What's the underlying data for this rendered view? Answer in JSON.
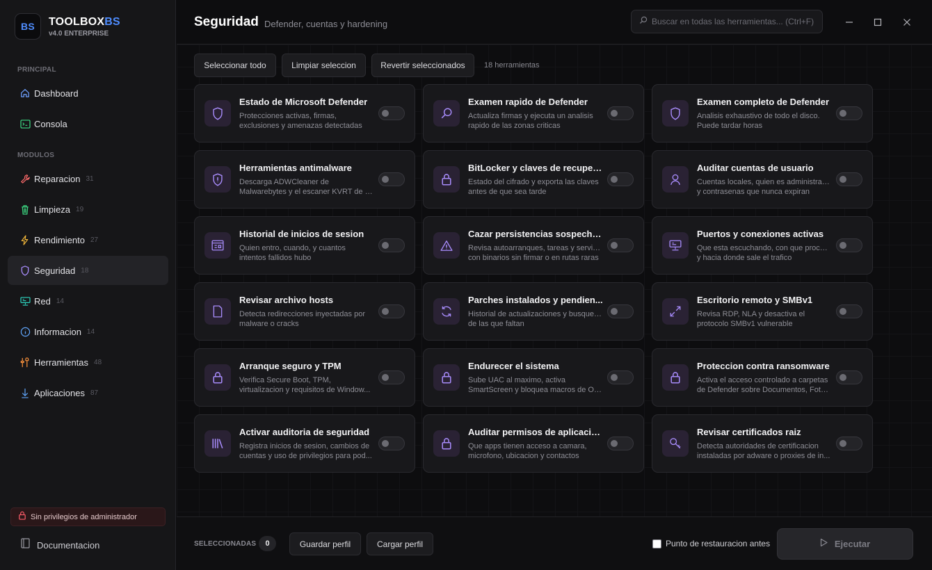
{
  "app": {
    "name_main": "TOOLBOX",
    "name_accent": "BS",
    "logo_text": "BS",
    "version": "v4.0 ENTERPRISE"
  },
  "sidebar": {
    "section_main": "PRINCIPAL",
    "section_modules": "MODULOS",
    "main_items": [
      {
        "label": "Dashboard",
        "icon": "home-icon"
      },
      {
        "label": "Consola",
        "icon": "terminal-icon"
      }
    ],
    "module_items": [
      {
        "label": "Reparacion",
        "count": "31",
        "icon": "wrench-icon",
        "color": "#ff6b6b"
      },
      {
        "label": "Limpieza",
        "count": "19",
        "icon": "trash-icon",
        "color": "#3ddc84"
      },
      {
        "label": "Rendimiento",
        "count": "27",
        "icon": "bolt-icon",
        "color": "#f5b93a"
      },
      {
        "label": "Seguridad",
        "count": "18",
        "icon": "shield-icon",
        "color": "#a78bfa"
      },
      {
        "label": "Red",
        "count": "14",
        "icon": "network-icon",
        "color": "#2dd4bf"
      },
      {
        "label": "Informacion",
        "count": "14",
        "icon": "info-icon",
        "color": "#60a5fa"
      },
      {
        "label": "Herramientas",
        "count": "48",
        "icon": "tools-icon",
        "color": "#fb923c"
      },
      {
        "label": "Aplicaciones",
        "count": "87",
        "icon": "download-icon",
        "color": "#60a5fa"
      }
    ],
    "admin_warning": "Sin privilegios de administrador",
    "docs_label": "Documentacion"
  },
  "header": {
    "title": "Seguridad",
    "subtitle": "Defender, cuentas y hardening",
    "search_placeholder": "Buscar en todas las herramientas... (Ctrl+F)"
  },
  "toolbar": {
    "select_all": "Seleccionar todo",
    "clear_selection": "Limpiar seleccion",
    "revert_selected": "Revertir seleccionados",
    "tool_count": "18 herramientas"
  },
  "tools": [
    {
      "title": "Estado de Microsoft Defender",
      "desc1": "Protecciones activas, firmas,",
      "desc2": "exclusiones y amenazas detectadas",
      "icon": "shield-icon",
      "enabled": false
    },
    {
      "title": "Examen rapido de Defender",
      "desc1": "Actualiza firmas y ejecuta un analisis",
      "desc2": "rapido de las zonas criticas",
      "icon": "search-icon",
      "enabled": false
    },
    {
      "title": "Examen completo de Defender",
      "desc1": "Analisis exhaustivo de todo el disco.",
      "desc2": "Puede tardar horas",
      "icon": "shield-icon",
      "enabled": false
    },
    {
      "title": "Herramientas antimalware",
      "desc1": "Descarga ADWCleaner de",
      "desc2": "Malwarebytes y el escaner KVRT de K...",
      "icon": "shield-alert-icon",
      "enabled": false
    },
    {
      "title": "BitLocker y claves de recuper...",
      "desc1": "Estado del cifrado y exporta las claves",
      "desc2": "antes de que sea tarde",
      "icon": "lock-icon",
      "enabled": false
    },
    {
      "title": "Auditar cuentas de usuario",
      "desc1": "Cuentas locales, quien es administrador",
      "desc2": "y contrasenas que nunca expiran",
      "icon": "user-icon",
      "enabled": false
    },
    {
      "title": "Historial de inicios de sesion",
      "desc1": "Quien entro, cuando, y cuantos",
      "desc2": "intentos fallidos hubo",
      "icon": "log-icon",
      "enabled": false
    },
    {
      "title": "Cazar persistencias sospecho...",
      "desc1": "Revisa autoarranques, tareas y servicios",
      "desc2": "con binarios sin firmar o en rutas raras",
      "icon": "warning-icon",
      "enabled": false
    },
    {
      "title": "Puertos y conexiones activas",
      "desc1": "Que esta escuchando, con que proceso",
      "desc2": "y hacia donde sale el trafico",
      "icon": "monitor-network-icon",
      "enabled": false
    },
    {
      "title": "Revisar archivo hosts",
      "desc1": "Detecta redirecciones inyectadas por",
      "desc2": "malware o cracks",
      "icon": "file-icon",
      "enabled": false
    },
    {
      "title": "Parches instalados y pendien...",
      "desc1": "Historial de actualizaciones y busqueda",
      "desc2": "de las que faltan",
      "icon": "refresh-icon",
      "enabled": false
    },
    {
      "title": "Escritorio remoto y SMBv1",
      "desc1": "Revisa RDP, NLA y desactiva el",
      "desc2": "protocolo SMBv1 vulnerable",
      "icon": "remote-icon",
      "enabled": false
    },
    {
      "title": "Arranque seguro y TPM",
      "desc1": "Verifica Secure Boot, TPM,",
      "desc2": "virtualizacion y requisitos de Window...",
      "icon": "lock-icon",
      "enabled": false
    },
    {
      "title": "Endurecer el sistema",
      "desc1": "Sube UAC al maximo, activa",
      "desc2": "SmartScreen y bloquea macros de Off...",
      "icon": "lock-icon",
      "enabled": false
    },
    {
      "title": "Proteccion contra ransomware",
      "desc1": "Activa el acceso controlado a carpetas",
      "desc2": "de Defender sobre Documentos, Foto...",
      "icon": "lock-icon",
      "enabled": false
    },
    {
      "title": "Activar auditoria de seguridad",
      "desc1": "Registra inicios de sesion, cambios de",
      "desc2": "cuentas y uso de privilegios para pod...",
      "icon": "books-icon",
      "enabled": false
    },
    {
      "title": "Auditar permisos de aplicacio...",
      "desc1": "Que apps tienen acceso a camara,",
      "desc2": "microfono, ubicacion y contactos",
      "icon": "lock-icon",
      "enabled": false
    },
    {
      "title": "Revisar certificados raiz",
      "desc1": "Detecta autoridades de certificacion",
      "desc2": "instaladas por adware o proxies de in...",
      "icon": "key-icon",
      "enabled": false
    }
  ],
  "footer": {
    "selected_label": "SELECCIONADAS",
    "selected_count": "0",
    "save_profile": "Guardar perfil",
    "load_profile": "Cargar perfil",
    "restore_point": "Punto de restauracion antes",
    "run": "Ejecutar"
  },
  "colors": {
    "accent": "#4f8dff",
    "security": "#a78bfa",
    "danger": "#ff6b6b"
  }
}
